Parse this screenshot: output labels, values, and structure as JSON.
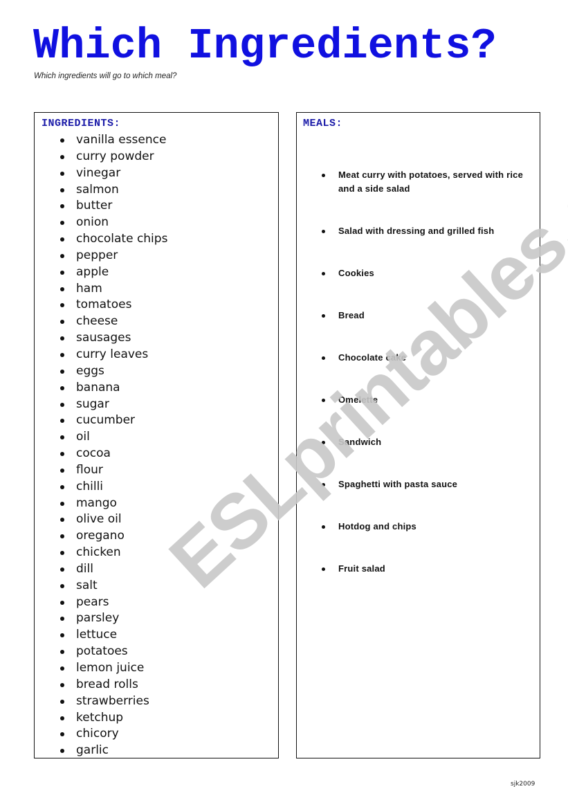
{
  "header": {
    "title": "Which Ingredients?",
    "subtitle": "Which ingredients will go to which meal?"
  },
  "ingredients": {
    "heading": "INGREDIENTS:",
    "items": [
      "vanilla essence",
      "curry powder",
      "vinegar",
      "salmon",
      "butter",
      "onion",
      "chocolate chips",
      "pepper",
      "apple",
      "ham",
      "tomatoes",
      "cheese",
      "sausages",
      "curry leaves",
      "eggs",
      "banana",
      "sugar",
      "cucumber",
      "oil",
      "cocoa",
      "flour",
      "chilli",
      "mango",
      "olive oil",
      "oregano",
      "chicken",
      "dill",
      "salt",
      "pears",
      "parsley",
      "lettuce",
      "potatoes",
      "lemon juice",
      "bread rolls",
      "strawberries",
      "ketchup",
      "chicory",
      "garlic"
    ]
  },
  "meals": {
    "heading": "MEALS:",
    "items": [
      "Meat curry with potatoes, served with rice and a side salad",
      "Salad with dressing and grilled fish",
      "Cookies",
      "Bread",
      "Chocolate cake",
      "Omelette",
      "Sandwich",
      "Spaghetti with pasta sauce",
      "Hotdog and chips",
      "Fruit salad"
    ]
  },
  "watermark": "ESLprintables.com",
  "footer": {
    "credit": "sjk2009"
  },
  "colors": {
    "title": "#1010e0",
    "heading": "#1a1aa8",
    "watermark": "#c8c8c8"
  }
}
